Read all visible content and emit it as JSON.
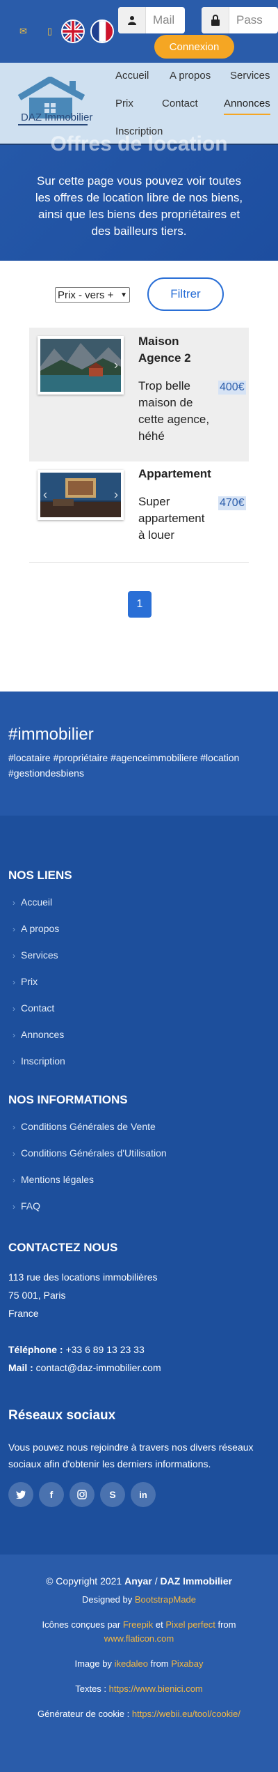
{
  "topbar": {
    "email_icon": "envelope-icon",
    "phone_icon": "phone-icon",
    "flags": [
      "uk-flag-icon",
      "france-flag-icon"
    ],
    "mail_placeholder": "Mail",
    "password_placeholder": "Pass",
    "connexion_label": "Connexion"
  },
  "brand": {
    "logo_text": "DAZ Immobilier"
  },
  "nav": {
    "items": [
      "Accueil",
      "A propos",
      "Services",
      "Prix",
      "Contact",
      "Annonces",
      "Inscription"
    ],
    "active": "Annonces"
  },
  "hero": {
    "title": "Offres de location",
    "text": "Sur cette page vous pouvez voir toutes les offres de location libre de nos biens, ainsi que les biens des propriétaires et des bailleurs tiers."
  },
  "filter": {
    "sort_value": "Prix - vers +",
    "button_label": "Filtrer"
  },
  "listings": [
    {
      "title_lines": [
        "Maison",
        "Agence 2"
      ],
      "desc_lines": [
        "Trop belle",
        "maison de",
        "cette agence,",
        "héhé"
      ],
      "price": "400€"
    },
    {
      "title_lines": [
        "Appartement"
      ],
      "desc_lines": [
        "Super",
        "appartement",
        "à louer"
      ],
      "price": "470€"
    }
  ],
  "pagination": {
    "current": "1"
  },
  "hashtags": {
    "title": "#immobilier",
    "line1": "#locataire #propriétaire #agenceimmobiliere #location",
    "line2": "#gestiondesbiens"
  },
  "footer": {
    "links_title": "NOS LIENS",
    "links": [
      "Accueil",
      "A propos",
      "Services",
      "Prix",
      "Contact",
      "Annonces",
      "Inscription"
    ],
    "info_title": "NOS INFORMATIONS",
    "info_links": [
      "Conditions Générales de Vente",
      "Conditions Générales d'Utilisation",
      "Mentions légales",
      "FAQ"
    ],
    "contact_title": "CONTACTEZ NOUS",
    "address": [
      "113 rue des locations immobilières",
      "75 001, Paris",
      "France"
    ],
    "phone_label": "Téléphone :",
    "phone": "+33 6 89 13 23 33",
    "mail_label": "Mail :",
    "mail": "contact@daz-immobilier.com",
    "social_title": "Réseaux sociaux",
    "social_text_1": "Vous pouvez nous rejoindre à travers nos divers réseaux",
    "social_text_2": "sociaux afin d'obtenir les derniers informations.",
    "social_icons": [
      "twitter-icon",
      "facebook-icon",
      "instagram-icon",
      "skype-icon",
      "linkedin-icon"
    ]
  },
  "bottom": {
    "copyright_prefix": "© Copyright 2021",
    "copyright_brand_1": "Anyar",
    "copyright_sep": "/",
    "copyright_brand_2": "DAZ Immobilier",
    "designed_by": "Designed by",
    "designer": "BootstrapMade",
    "icons_text": "Icônes conçues par",
    "icons_author_1": "Freepik",
    "icons_and": "et",
    "icons_author_2": "Pixel perfect",
    "icons_from": "from",
    "icons_site": "www.flaticon.com",
    "image_by": "Image by",
    "image_author": "ikedaleo",
    "image_from": "from",
    "image_site": "Pixabay",
    "texts_label": "Textes :",
    "texts_site": "https://www.bienici.com",
    "cookie_label": "Générateur de cookie :",
    "cookie_site": "https://webii.eu/tool/cookie/"
  }
}
